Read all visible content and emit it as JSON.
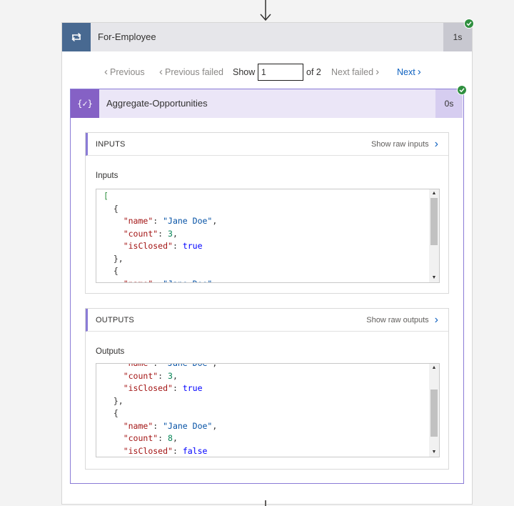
{
  "loop_action": {
    "title": "For-Employee",
    "duration": "1s",
    "status_color": "#2f8f3f",
    "icon": "loop-icon"
  },
  "pager": {
    "previous_label": "Previous",
    "previous_failed_label": "Previous failed",
    "show_label": "Show",
    "page_value": "1",
    "of_label": "of 2",
    "next_failed_label": "Next failed",
    "next_label": "Next"
  },
  "compose_action": {
    "title": "Aggregate-Opportunities",
    "duration": "0s",
    "icon_glyph": "{✓}",
    "icon": "compose-icon"
  },
  "inputs_panel": {
    "header": "INPUTS",
    "raw_link": "Show raw inputs",
    "field_label": "Inputs",
    "scroll_position": 0.0,
    "lines": [
      [
        {
          "t": "[",
          "c": "cursor"
        }
      ],
      [
        {
          "t": "  {",
          "c": ""
        }
      ],
      [
        {
          "t": "    ",
          "c": ""
        },
        {
          "t": "\"name\"",
          "c": "key"
        },
        {
          "t": ": ",
          "c": ""
        },
        {
          "t": "\"Jane Doe\"",
          "c": "str"
        },
        {
          "t": ",",
          "c": ""
        }
      ],
      [
        {
          "t": "    ",
          "c": ""
        },
        {
          "t": "\"count\"",
          "c": "key"
        },
        {
          "t": ": ",
          "c": ""
        },
        {
          "t": "3",
          "c": "num"
        },
        {
          "t": ",",
          "c": ""
        }
      ],
      [
        {
          "t": "    ",
          "c": ""
        },
        {
          "t": "\"isClosed\"",
          "c": "key"
        },
        {
          "t": ": ",
          "c": ""
        },
        {
          "t": "true",
          "c": "bool"
        }
      ],
      [
        {
          "t": "  },",
          "c": ""
        }
      ],
      [
        {
          "t": "  {",
          "c": ""
        }
      ],
      [
        {
          "t": "    ",
          "c": ""
        },
        {
          "t": "\"name\"",
          "c": "key"
        },
        {
          "t": ": ",
          "c": ""
        },
        {
          "t": "\"Jane Doe\"",
          "c": "str"
        },
        {
          "t": ",",
          "c": ""
        }
      ]
    ]
  },
  "outputs_panel": {
    "header": "OUTPUTS",
    "raw_link": "Show raw outputs",
    "field_label": "Outputs",
    "scroll_position": 0.6,
    "lines": [
      [
        {
          "t": "    ",
          "c": ""
        },
        {
          "t": "\"name\"",
          "c": "key"
        },
        {
          "t": ": ",
          "c": ""
        },
        {
          "t": "\"Jane Doe\"",
          "c": "str"
        },
        {
          "t": ",",
          "c": ""
        }
      ],
      [
        {
          "t": "    ",
          "c": ""
        },
        {
          "t": "\"count\"",
          "c": "key"
        },
        {
          "t": ": ",
          "c": ""
        },
        {
          "t": "3",
          "c": "num"
        },
        {
          "t": ",",
          "c": ""
        }
      ],
      [
        {
          "t": "    ",
          "c": ""
        },
        {
          "t": "\"isClosed\"",
          "c": "key"
        },
        {
          "t": ": ",
          "c": ""
        },
        {
          "t": "true",
          "c": "bool"
        }
      ],
      [
        {
          "t": "  },",
          "c": ""
        }
      ],
      [
        {
          "t": "  {",
          "c": ""
        }
      ],
      [
        {
          "t": "    ",
          "c": ""
        },
        {
          "t": "\"name\"",
          "c": "key"
        },
        {
          "t": ": ",
          "c": ""
        },
        {
          "t": "\"Jane Doe\"",
          "c": "str"
        },
        {
          "t": ",",
          "c": ""
        }
      ],
      [
        {
          "t": "    ",
          "c": ""
        },
        {
          "t": "\"count\"",
          "c": "key"
        },
        {
          "t": ": ",
          "c": ""
        },
        {
          "t": "8",
          "c": "num"
        },
        {
          "t": ",",
          "c": ""
        }
      ],
      [
        {
          "t": "    ",
          "c": ""
        },
        {
          "t": "\"isClosed\"",
          "c": "key"
        },
        {
          "t": ": ",
          "c": ""
        },
        {
          "t": "false",
          "c": "bool"
        }
      ]
    ]
  },
  "colors": {
    "loop_accent": "#486991",
    "compose_accent": "#8561c5",
    "link_blue": "#0f62c0",
    "success_green": "#2f8f3f"
  }
}
